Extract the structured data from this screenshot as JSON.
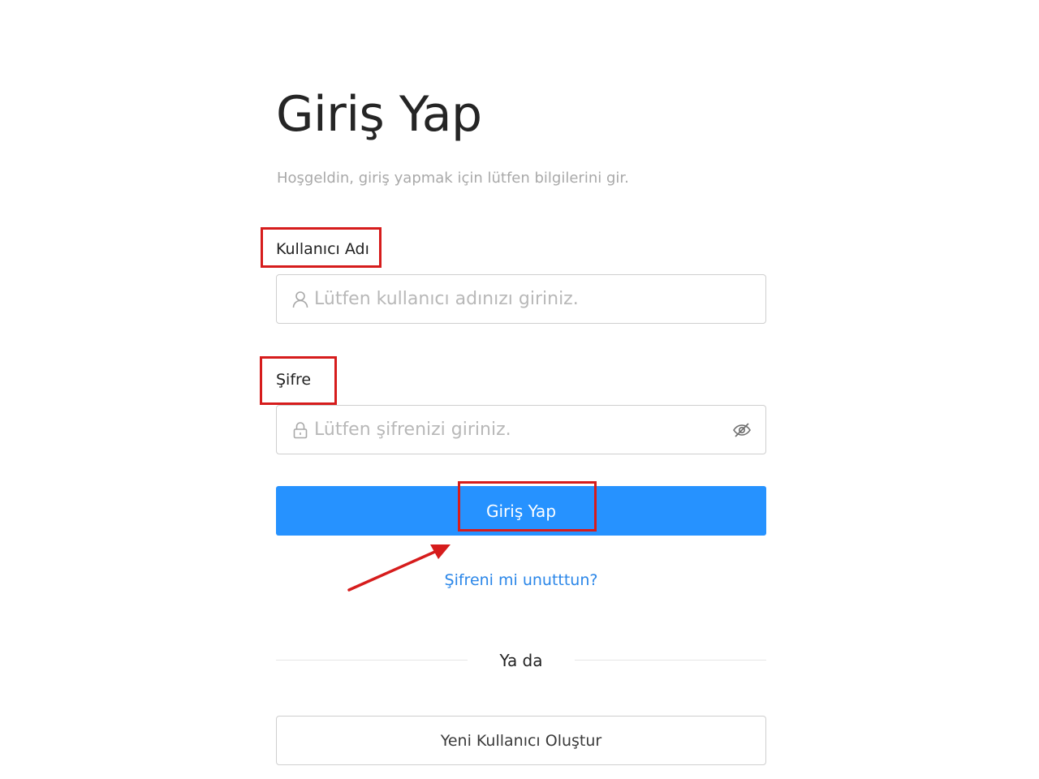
{
  "login": {
    "title": "Giriş Yap",
    "subtitle": "Hoşgeldin, giriş yapmak için lütfen bilgilerini gir.",
    "username": {
      "label": "Kullanıcı Adı",
      "placeholder": "Lütfen kullanıcı adınızı giriniz.",
      "value": "",
      "icon": "user-icon"
    },
    "password": {
      "label": "Şifre",
      "placeholder": "Lütfen şifrenizi giriniz.",
      "value": "",
      "icon": "lock-icon",
      "toggle_icon": "eye-off-icon"
    },
    "submit_label": "Giriş Yap",
    "forgot_label": "Şifreni mi unutttun?",
    "divider_label": "Ya da",
    "create_account_label": "Yeni Kullanıcı Oluştur"
  },
  "colors": {
    "primary": "#2692ff",
    "link": "#2a86e8",
    "annotation": "#d61c1c"
  }
}
